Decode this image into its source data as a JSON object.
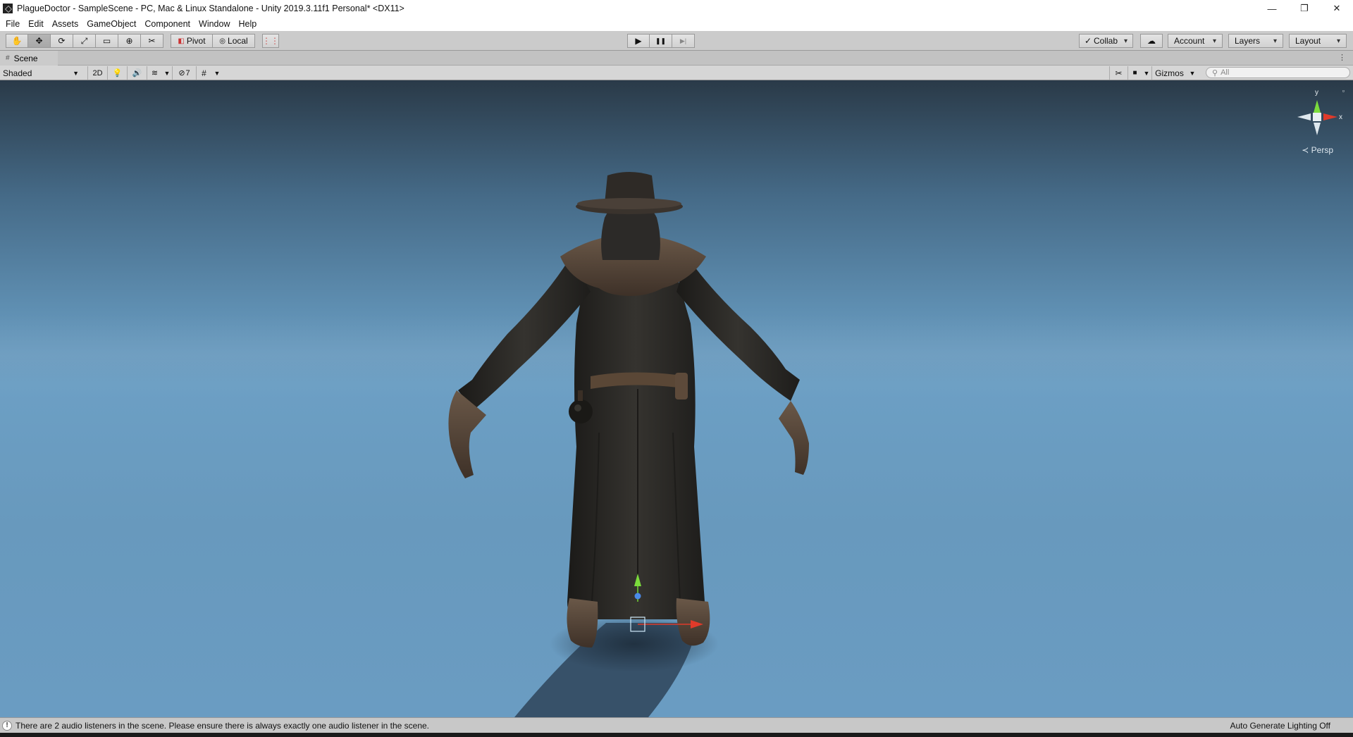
{
  "window": {
    "title": "PlagueDoctor - SampleScene - PC, Mac & Linux Standalone - Unity 2019.3.11f1 Personal* <DX11>",
    "controls": {
      "minimize": "—",
      "restore": "❐",
      "close": "✕"
    }
  },
  "menu": [
    "File",
    "Edit",
    "Assets",
    "GameObject",
    "Component",
    "Window",
    "Help"
  ],
  "toolbar": {
    "tools": [
      {
        "name": "hand-tool",
        "glyph": "✋"
      },
      {
        "name": "move-tool",
        "glyph": "✥"
      },
      {
        "name": "rotate-tool",
        "glyph": "⟳"
      },
      {
        "name": "scale-tool",
        "glyph": "⤢"
      },
      {
        "name": "rect-tool",
        "glyph": "▭"
      },
      {
        "name": "transform-tool",
        "glyph": "⊕"
      },
      {
        "name": "custom-tool",
        "glyph": "✂"
      }
    ],
    "pivot_label": "Pivot",
    "local_label": "Local",
    "snap_glyph": "⋮⋮",
    "play": {
      "play": "▶",
      "pause": "❚❚",
      "step": "▶|"
    },
    "collab_label": "Collab",
    "cloud_glyph": "☁",
    "account_label": "Account",
    "layers_label": "Layers",
    "layout_label": "Layout"
  },
  "scene_tab": {
    "label": "Scene",
    "icon": "#",
    "menu": "⋮"
  },
  "scene_controls": {
    "draw_mode": "Shaded",
    "mode_2d": "2D",
    "lighting_glyph": "💡",
    "audio_glyph": "🔊",
    "effects_glyph": "≋",
    "hidden_count": "7",
    "hidden_glyph": "⊘",
    "grid_glyph": "#",
    "tools_glyph": "✂",
    "camera_glyph": "■",
    "gizmos_label": "Gizmos",
    "search_placeholder": "All",
    "search_glyph": "⚲"
  },
  "viewport": {
    "gizmo_axes": {
      "y": "y",
      "x": "x"
    },
    "projection_label": "≺ Persp",
    "lock_glyph": "🔒",
    "colors": {
      "sky_top": "#2a3a48",
      "ground": "#6a9cc2",
      "y_axis": "#7bdc3c",
      "x_axis": "#e03a2a",
      "z_axis": "#4a8ae8"
    }
  },
  "status": {
    "message": "There are 2 audio listeners in the scene. Please ensure there is always exactly one audio listener in the scene.",
    "right": "Auto Generate Lighting Off"
  }
}
